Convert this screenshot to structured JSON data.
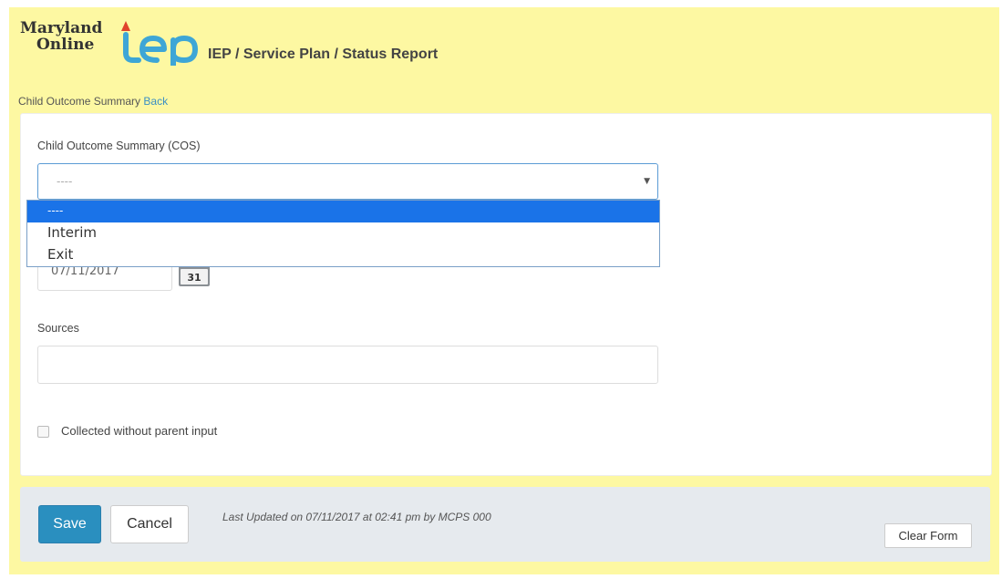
{
  "header": {
    "logo_line1": "Maryland",
    "logo_line2": "Online",
    "logo_mark": "IEP",
    "app_title": "IEP / Service Plan / Status Report"
  },
  "breadcrumb": {
    "current": "Child Outcome Summary",
    "back_label": "Back"
  },
  "form": {
    "cos_label": "Child Outcome Summary (COS)",
    "cos_select": {
      "value": "----",
      "options": [
        "----",
        "Interim",
        "Exit"
      ],
      "selected_index": 0
    },
    "date_value": "07/11/2017",
    "sources_label": "Sources",
    "sources_value": "",
    "checkbox_label": "Collected without parent input",
    "checkbox_checked": false
  },
  "footer": {
    "save_label": "Save",
    "cancel_label": "Cancel",
    "last_updated": "Last Updated on 07/11/2017 at 02:41 pm by MCPS 000",
    "clear_label": "Clear Form"
  },
  "colors": {
    "background": "#fdf8a2",
    "accent": "#2a8fbf",
    "link": "#3a8fc4",
    "selected_option": "#1a73e8"
  }
}
